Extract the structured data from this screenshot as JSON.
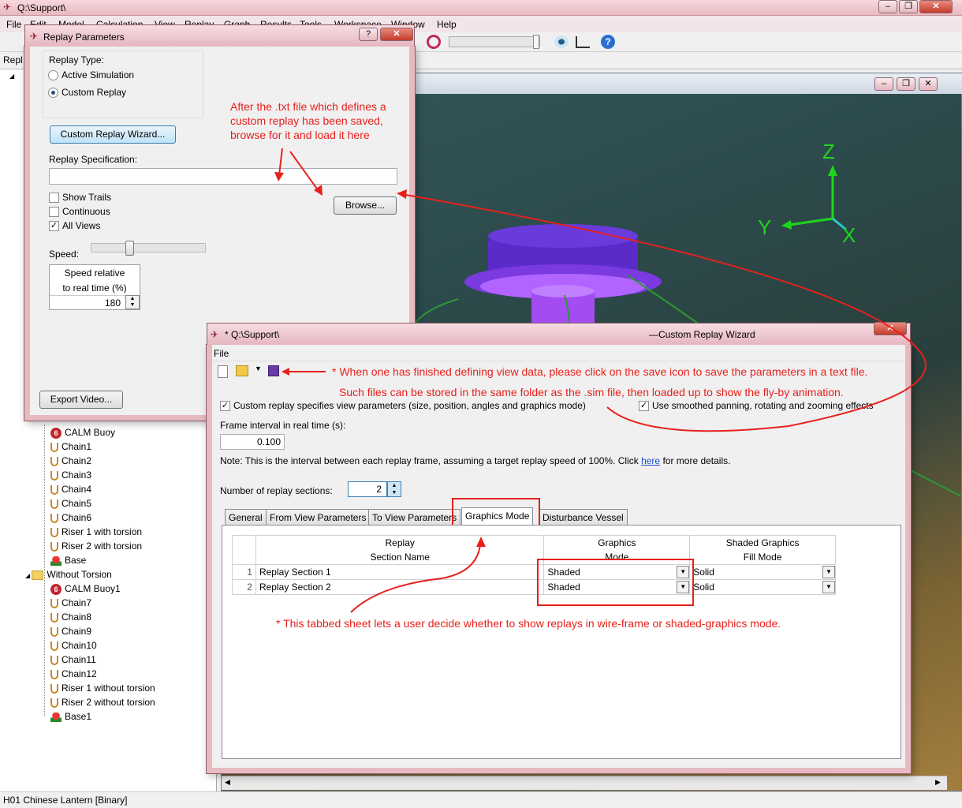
{
  "app": {
    "title": "Q:\\Support\\",
    "menu": [
      "File",
      "Edit",
      "Model",
      "Calculation",
      "View",
      "Replay",
      "Graph",
      "Results",
      "Tools",
      "Workspace",
      "Window",
      "Help"
    ],
    "tab_partial": "Repl",
    "status": "H01 Chinese Lantern [Binary]"
  },
  "tree": {
    "items": [
      {
        "label": "CALM Buoy",
        "kind": "buoy"
      },
      {
        "label": "Chain1",
        "kind": "chain"
      },
      {
        "label": "Chain2",
        "kind": "chain"
      },
      {
        "label": "Chain3",
        "kind": "chain"
      },
      {
        "label": "Chain4",
        "kind": "chain"
      },
      {
        "label": "Chain5",
        "kind": "chain"
      },
      {
        "label": "Chain6",
        "kind": "chain"
      },
      {
        "label": "Riser 1 with torsion",
        "kind": "chain"
      },
      {
        "label": "Riser 2 with torsion",
        "kind": "chain"
      },
      {
        "label": "Base",
        "kind": "base"
      },
      {
        "label": "Without Torsion",
        "kind": "folder"
      },
      {
        "label": "CALM Buoy1",
        "kind": "buoy"
      },
      {
        "label": "Chain7",
        "kind": "chain"
      },
      {
        "label": "Chain8",
        "kind": "chain"
      },
      {
        "label": "Chain9",
        "kind": "chain"
      },
      {
        "label": "Chain10",
        "kind": "chain"
      },
      {
        "label": "Chain11",
        "kind": "chain"
      },
      {
        "label": "Chain12",
        "kind": "chain"
      },
      {
        "label": "Riser 1 without torsion",
        "kind": "chain"
      },
      {
        "label": "Riser 2 without torsion",
        "kind": "chain"
      },
      {
        "label": "Base1",
        "kind": "base"
      }
    ]
  },
  "axes": {
    "z": "Z",
    "y": "Y",
    "x": "X"
  },
  "replay_params": {
    "title": "Replay Parameters",
    "help": "?",
    "replay_type_label": "Replay Type:",
    "option_active": "Active Simulation",
    "option_custom": "Custom Replay",
    "wizard_button": "Custom Replay Wizard...",
    "spec_label": "Replay Specification:",
    "spec_value": "",
    "browse_button": "Browse...",
    "show_trails": "Show Trails",
    "continuous": "Continuous",
    "all_views": "All Views",
    "speed_label": "Speed:",
    "speed_rel_line1": "Speed relative",
    "speed_rel_line2": "to real time (%)",
    "speed_value": "180",
    "export_button": "Export Video...",
    "annotation": "After the .txt file which defines a custom replay has been saved, browse for it and load it here"
  },
  "wizard": {
    "title_left": "* Q:\\Support\\",
    "title_right": "—Custom Replay Wizard",
    "menu_file": "File",
    "annotation_save": "* When one has finished defining view data, please click on the save icon to save the parameters in a text file.",
    "annotation_files": "Such files can be stored in the same folder as the .sim file, then loaded up to show the fly-by animation.",
    "chk_view_params": "Custom replay specifies view parameters (size, position, angles and graphics mode)",
    "chk_smoothed": "Use smoothed panning, rotating and zooming effects",
    "frame_label": "Frame interval in real time (s):",
    "frame_value": "0.100",
    "note_text": "Note: This is the interval between each replay frame, assuming a target replay speed of 100%.  Click",
    "note_link": "here",
    "note_tail": "for more details.",
    "sections_label": "Number of replay sections:",
    "sections_value": "2",
    "tabs": [
      "General",
      "From View Parameters",
      "To View Parameters",
      "Graphics Mode",
      "Disturbance Vessel"
    ],
    "active_tab": "Graphics Mode",
    "grid": {
      "headers": [
        [
          "Replay",
          "Section Name"
        ],
        [
          "Graphics",
          "Mode"
        ],
        [
          "Shaded Graphics",
          "Fill Mode"
        ]
      ],
      "rows": [
        {
          "num": "1",
          "name": "Replay Section 1",
          "mode": "Shaded",
          "fill": "Solid"
        },
        {
          "num": "2",
          "name": "Replay Section 2",
          "mode": "Shaded",
          "fill": "Solid"
        }
      ]
    },
    "annotation_tab": "* This tabbed sheet lets a user decide whether to show replays in wire-frame or shaded-graphics mode."
  },
  "colors": {
    "annotation": "#e8201c",
    "title_bar": "#e7b9c1",
    "link": "#1a4fc9"
  }
}
